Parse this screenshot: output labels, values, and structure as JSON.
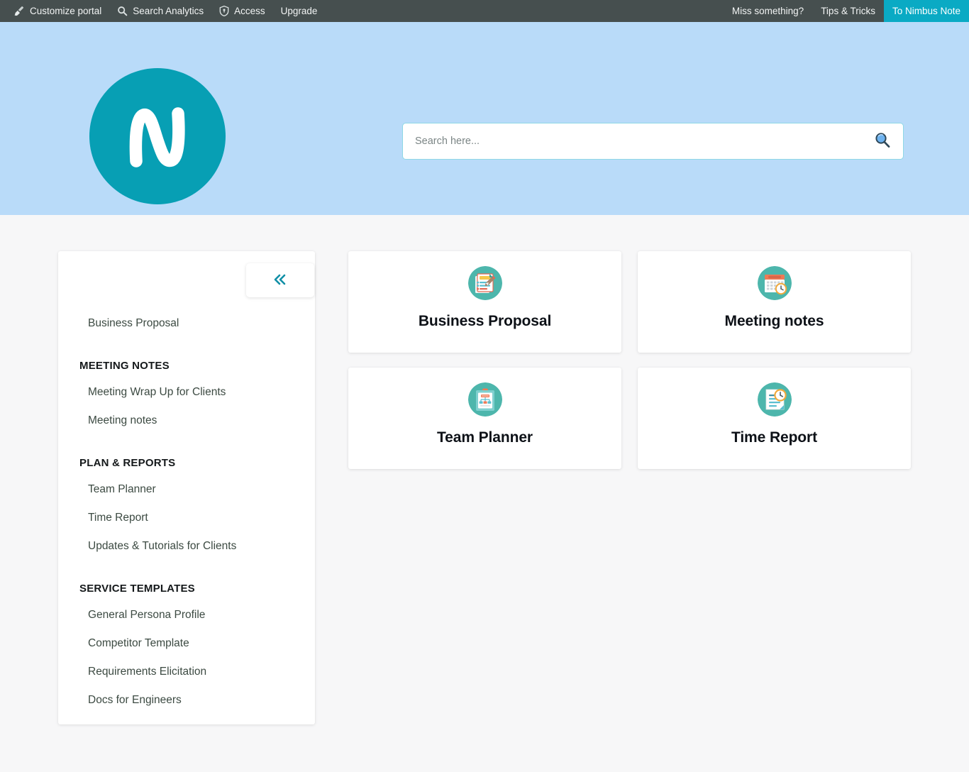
{
  "topbar": {
    "left_items": [
      {
        "label": "Customize portal",
        "icon": "brush-icon"
      },
      {
        "label": "Search Analytics",
        "icon": "search-icon"
      },
      {
        "label": "Access",
        "icon": "shield-icon"
      },
      {
        "label": "Upgrade",
        "icon": ""
      }
    ],
    "right_items": [
      {
        "label": "Miss something?",
        "highlight": false
      },
      {
        "label": "Tips & Tricks",
        "highlight": false
      },
      {
        "label": "To Nimbus Note",
        "highlight": true
      }
    ],
    "bg_color": "#464f4f",
    "highlight_color": "#0aaac4"
  },
  "banner": {
    "bg_color": "#b9dbf9",
    "logo": {
      "letter": "N",
      "circle_color": "#079fb4",
      "letter_color": "#ffffff"
    },
    "search": {
      "placeholder": "Search here...",
      "value": "",
      "icon": "magnifier-icon",
      "border_color": "#8fd8e6"
    }
  },
  "sidebar": {
    "collapse_label": "«",
    "collapse_color": "#0f8fa6",
    "entries": [
      {
        "type": "item",
        "label": "Business Proposal"
      },
      {
        "type": "group",
        "label": "MEETING NOTES"
      },
      {
        "type": "item",
        "label": "Meeting Wrap Up for Clients"
      },
      {
        "type": "item",
        "label": "Meeting notes"
      },
      {
        "type": "group",
        "label": "PLAN & REPORTS"
      },
      {
        "type": "item",
        "label": "Team Planner"
      },
      {
        "type": "item",
        "label": "Time Report"
      },
      {
        "type": "item",
        "label": "Updates & Tutorials for Clients"
      },
      {
        "type": "group",
        "label": "SERVICE TEMPLATES"
      },
      {
        "type": "item",
        "label": "General Persona Profile"
      },
      {
        "type": "item",
        "label": "Competitor Template"
      },
      {
        "type": "item",
        "label": "Requirements Elicitation"
      },
      {
        "type": "item",
        "label": "Docs for Engineers"
      }
    ]
  },
  "cards": [
    {
      "title": "Business Proposal",
      "icon": "document-checklist-pencil-icon",
      "icon_bg": "#4db6ac"
    },
    {
      "title": "Meeting notes",
      "icon": "calendar-clock-icon",
      "icon_bg": "#4db6ac"
    },
    {
      "title": "Team Planner",
      "icon": "clipboard-orgchart-icon",
      "icon_bg": "#4db6ac"
    },
    {
      "title": "Time Report",
      "icon": "document-clock-icon",
      "icon_bg": "#4db6ac"
    }
  ]
}
